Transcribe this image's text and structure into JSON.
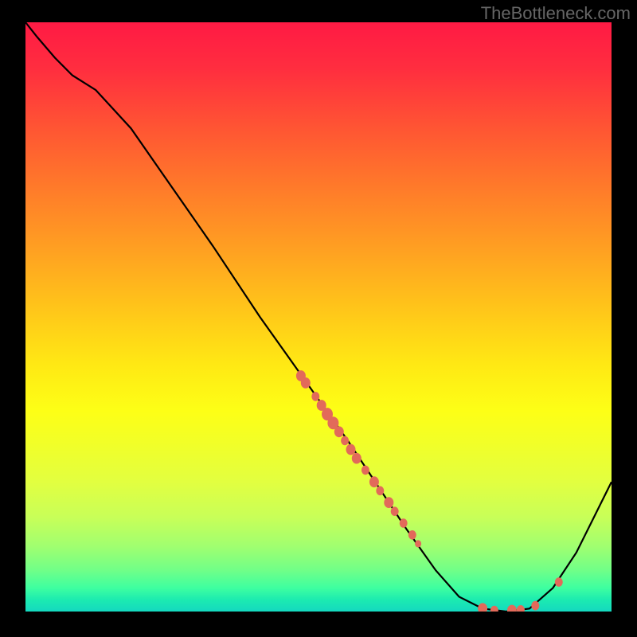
{
  "watermark": "TheBottleneck.com",
  "chart_data": {
    "type": "line",
    "title": "",
    "xlabel": "",
    "ylabel": "",
    "xlim": [
      0,
      100
    ],
    "ylim": [
      0,
      100
    ],
    "curve_points": [
      {
        "x": 0,
        "y": 100
      },
      {
        "x": 2,
        "y": 97.5
      },
      {
        "x": 5,
        "y": 94
      },
      {
        "x": 8,
        "y": 91
      },
      {
        "x": 12,
        "y": 88.5
      },
      {
        "x": 18,
        "y": 82
      },
      {
        "x": 25,
        "y": 72
      },
      {
        "x": 32,
        "y": 62
      },
      {
        "x": 40,
        "y": 50
      },
      {
        "x": 45,
        "y": 43
      },
      {
        "x": 50,
        "y": 36
      },
      {
        "x": 55,
        "y": 29
      },
      {
        "x": 60,
        "y": 21.5
      },
      {
        "x": 65,
        "y": 14
      },
      {
        "x": 70,
        "y": 7
      },
      {
        "x": 74,
        "y": 2.5
      },
      {
        "x": 78,
        "y": 0.5
      },
      {
        "x": 82,
        "y": 0
      },
      {
        "x": 86,
        "y": 0.5
      },
      {
        "x": 90,
        "y": 4
      },
      {
        "x": 94,
        "y": 10
      },
      {
        "x": 97,
        "y": 16
      },
      {
        "x": 100,
        "y": 22
      }
    ],
    "markers": [
      {
        "x": 47,
        "y": 40,
        "r": 6
      },
      {
        "x": 47.8,
        "y": 38.8,
        "r": 6
      },
      {
        "x": 49.5,
        "y": 36.5,
        "r": 5
      },
      {
        "x": 50.5,
        "y": 35,
        "r": 6
      },
      {
        "x": 51.5,
        "y": 33.5,
        "r": 7
      },
      {
        "x": 52.5,
        "y": 32,
        "r": 7
      },
      {
        "x": 53.5,
        "y": 30.5,
        "r": 6
      },
      {
        "x": 54.5,
        "y": 29,
        "r": 5
      },
      {
        "x": 55.5,
        "y": 27.5,
        "r": 6
      },
      {
        "x": 56.5,
        "y": 26,
        "r": 6
      },
      {
        "x": 58,
        "y": 24,
        "r": 5
      },
      {
        "x": 59.5,
        "y": 22,
        "r": 6
      },
      {
        "x": 60.5,
        "y": 20.5,
        "r": 5
      },
      {
        "x": 62,
        "y": 18.5,
        "r": 6
      },
      {
        "x": 63,
        "y": 17,
        "r": 5
      },
      {
        "x": 64.5,
        "y": 15,
        "r": 5
      },
      {
        "x": 66,
        "y": 13,
        "r": 5
      },
      {
        "x": 67,
        "y": 11.5,
        "r": 4
      },
      {
        "x": 78,
        "y": 0.5,
        "r": 6
      },
      {
        "x": 80,
        "y": 0.2,
        "r": 5
      },
      {
        "x": 83,
        "y": 0.2,
        "r": 6
      },
      {
        "x": 84.5,
        "y": 0.3,
        "r": 5
      },
      {
        "x": 87,
        "y": 1,
        "r": 5
      },
      {
        "x": 91,
        "y": 5,
        "r": 5
      }
    ]
  }
}
